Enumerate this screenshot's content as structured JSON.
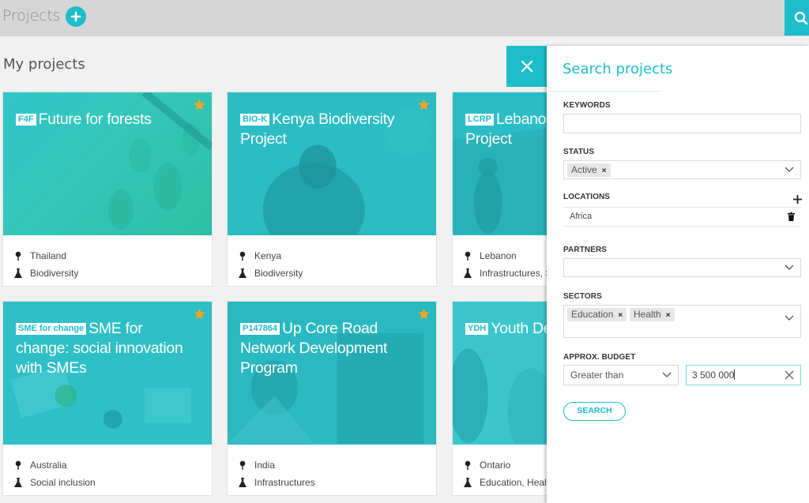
{
  "header": {
    "title": "Projects",
    "add_icon": "plus-circle-icon",
    "search_icon": "search-icon"
  },
  "section_title": "My projects",
  "colors": {
    "accent": "#1ebdcb",
    "star": "#f5a623",
    "topbar": "#d6d6d6",
    "background": "#f1f1f1"
  },
  "projects": [
    {
      "acronym": "F4F",
      "title": "Future for forests",
      "location": "Thailand",
      "sector": "Biodiversity",
      "starred": true
    },
    {
      "acronym": "BIO-K",
      "title": "Kenya Biodiversity Project",
      "location": "Kenya",
      "sector": "Biodiversity",
      "starred": true
    },
    {
      "acronym": "LCRP",
      "title": "Lebanon Refugee Project",
      "location": "Lebanon",
      "sector": "Infrastructures, S",
      "starred": false
    },
    {
      "acronym": "SME for change",
      "title": "SME for change: social innovation with SMEs",
      "location": "Australia",
      "sector": "Social inclusion",
      "starred": true
    },
    {
      "acronym": "P147864",
      "title": "Up Core Road Network Development Program",
      "location": "India",
      "sector": "Infrastructures",
      "starred": true
    },
    {
      "acronym": "YDH",
      "title": "Youth Development",
      "location": "Ontario",
      "sector": "Education, Health",
      "starred": false
    }
  ],
  "search_panel": {
    "title": "Search projects",
    "keywords": {
      "label": "KEYWORDS",
      "value": "",
      "placeholder": ""
    },
    "status": {
      "label": "STATUS",
      "tags": [
        "Active"
      ]
    },
    "locations": {
      "label": "LOCATIONS",
      "items": [
        "Africa"
      ]
    },
    "partners": {
      "label": "PARTNERS",
      "tags": []
    },
    "sectors": {
      "label": "SECTORS",
      "tags": [
        "Education",
        "Health"
      ]
    },
    "budget": {
      "label": "APPROX. BUDGET",
      "operator": "Greater than",
      "value": "3 500 000"
    },
    "search_button": "SEARCH"
  }
}
